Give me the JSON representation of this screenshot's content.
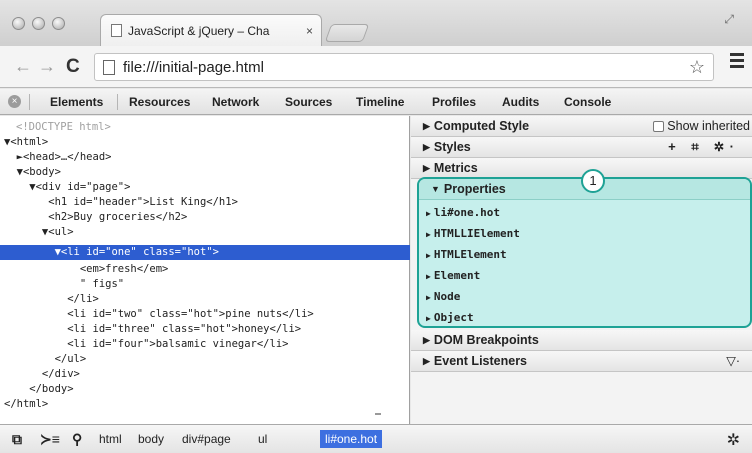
{
  "window": {
    "tab_title": "JavaScript & jQuery – Cha",
    "tab_close": "×"
  },
  "navbar": {
    "url": "file:///initial-page.html",
    "back_glyph": "←",
    "forward_glyph": "→",
    "reload_glyph": "C",
    "star_glyph": "☆"
  },
  "devtools": {
    "close_glyph": "×",
    "tabs": [
      "Elements",
      "Resources",
      "Network",
      "Sources",
      "Timeline",
      "Profiles",
      "Audits",
      "Console"
    ],
    "active_tab": "Elements"
  },
  "elements": {
    "lines": [
      "<!DOCTYPE html>",
      "▼<html>",
      "  ►<head>…</head>",
      "  ▼<body>",
      "    ▼<div id=\"page\">",
      "       <h1 id=\"header\">List King</h1>",
      "       <h2>Buy groceries</h2>",
      "      ▼<ul>",
      "        ▼<li id=\"one\" class=\"hot\">",
      "            <em>fresh</em>",
      "            \" figs\"",
      "          </li>",
      "          <li id=\"two\" class=\"hot\">pine nuts</li>",
      "          <li id=\"three\" class=\"hot\">honey</li>",
      "          <li id=\"four\">balsamic vinegar</li>",
      "        </ul>",
      "      </div>",
      "    </body>",
      "</html>"
    ]
  },
  "sidebar": {
    "computed_style": "Computed Style",
    "show_inherited": "Show inherited",
    "styles": "Styles",
    "styles_tools": "+ ⌗ ✲·",
    "metrics": "Metrics",
    "properties": "Properties",
    "properties_items": [
      "li#one.hot",
      "HTMLLIElement",
      "HTMLElement",
      "Element",
      "Node",
      "Object"
    ],
    "dom_breakpoints": "DOM Breakpoints",
    "event_listeners": "Event Listeners",
    "filter_glyph": "▽·",
    "callout_number": "1",
    "highlight_color": "#c6efec",
    "highlight_border": "#1ea295"
  },
  "statusbar": {
    "breadcrumbs": [
      "html",
      "body",
      "div#page",
      "ul",
      "li#one.hot"
    ],
    "active_crumb": "li#one.hot",
    "gear_glyph": "✲"
  }
}
